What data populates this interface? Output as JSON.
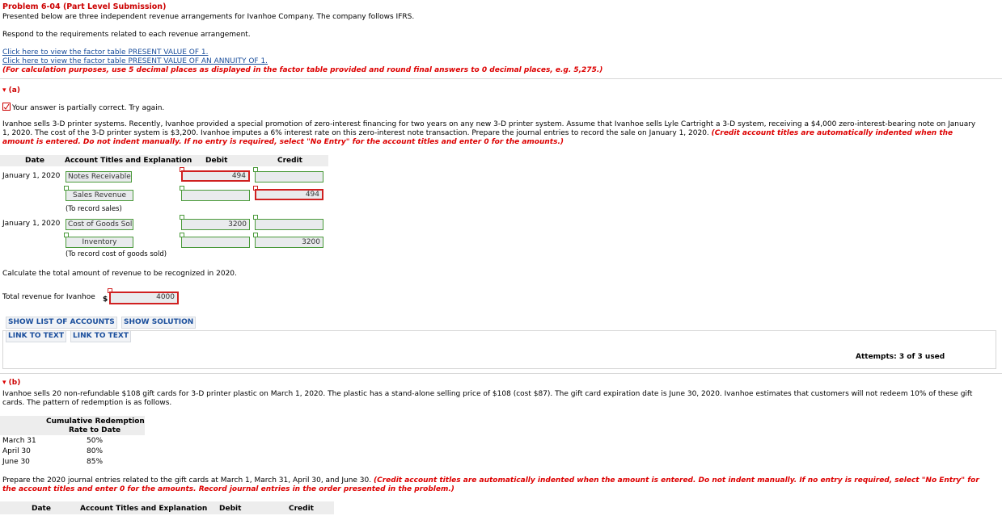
{
  "header": {
    "title": "Problem 6-04 (Part Level Submission)",
    "intro": "Presented below are three independent revenue arrangements for Ivanhoe Company. The company follows IFRS.",
    "respond": "Respond to the requirements related to each revenue arrangement.",
    "link1": "Click here to view the factor table PRESENT VALUE OF 1.",
    "link2": "Click here to view the factor table PRESENT VALUE OF AN ANNUITY OF 1.",
    "calc_note": "(For calculation purposes, use 5 decimal places as displayed in the factor table provided and round final answers to 0 decimal places, e.g. 5,275.)"
  },
  "part_a": {
    "label": "(a)",
    "status": "Your answer is partially correct.  Try again.",
    "problem_line1": "Ivanhoe sells 3-D printer systems. Recently, Ivanhoe provided a special promotion of zero-interest financing for two years on any new 3-D printer system. Assume that Ivanhoe sells Lyle Cartright a 3-D system, receiving a $4,000 zero-interest-bearing note on January",
    "problem_line2_plain": "1, 2020. The cost of the 3-D printer system is $3,200. Ivanhoe imputes a 6% interest rate on this zero-interest note transaction. Prepare the journal entries to record the sale on January 1, 2020. ",
    "problem_line2_red": "(Credit account titles are automatically indented when the",
    "problem_line3_red": "amount is entered. Do not indent manually. If no entry is required, select \"No Entry\" for the account titles and enter 0 for the amounts.)",
    "table_headers": {
      "date": "Date",
      "account": "Account Titles and Explanation",
      "debit": "Debit",
      "credit": "Credit"
    },
    "entry1": {
      "date": "January 1, 2020",
      "debit_account": "Notes Receivable",
      "debit_amount": "494",
      "credit_account": "Sales Revenue",
      "credit_amount": "494",
      "explanation": "(To record sales)"
    },
    "entry2": {
      "date": "January 1, 2020",
      "debit_account": "Cost of Goods Sol",
      "debit_amount": "3200",
      "credit_account": "Inventory",
      "credit_amount": "3200",
      "explanation": "(To record cost of goods sold)"
    },
    "calc_prompt": "Calculate the total amount of revenue to be recognized in 2020.",
    "total_label": "Total revenue for Ivanhoe",
    "currency": "$",
    "total_value": "4000",
    "buttons": {
      "show_accounts": "SHOW LIST OF ACCOUNTS",
      "show_solution": "SHOW SOLUTION",
      "link_text_1": "LINK TO TEXT",
      "link_text_2": "LINK TO TEXT"
    },
    "attempts": "Attempts: 3 of 3 used"
  },
  "part_b": {
    "label": "(b)",
    "problem_line1": "Ivanhoe sells 20 non-refundable $108 gift cards for 3-D printer plastic on March 1, 2020. The plastic has a stand-alone selling price of $108 (cost $87). The gift card expiration date is June 30, 2020. Ivanhoe estimates that customers will not redeem 10% of these gift",
    "problem_line2": "cards. The pattern of redemption is as follows.",
    "redemption_header_1": "Cumulative Redemption",
    "redemption_header_2": "Rate to Date",
    "redemption_rows": [
      {
        "month": "March 31",
        "rate": "50%"
      },
      {
        "month": "April 30",
        "rate": "80%"
      },
      {
        "month": "June 30",
        "rate": "85%"
      }
    ],
    "prepare_plain": "Prepare the 2020 journal entries related to the gift cards at March 1, March 31, April 30, and June 30. ",
    "prepare_red1": "(Credit account titles are automatically indented when the amount is entered. Do not indent manually. If no entry is required, select \"No Entry\" for",
    "prepare_red2": "the account titles and enter 0 for the amounts. Record journal entries in the order presented in the problem.)",
    "table_headers": {
      "date": "Date",
      "account": "Account Titles and Explanation",
      "debit": "Debit",
      "credit": "Credit"
    }
  },
  "colors": {
    "accent_red": "#cc0000",
    "link_blue": "#1a4e9c",
    "input_border_green": "#4a9a3a",
    "error_border_red": "#d02020"
  }
}
